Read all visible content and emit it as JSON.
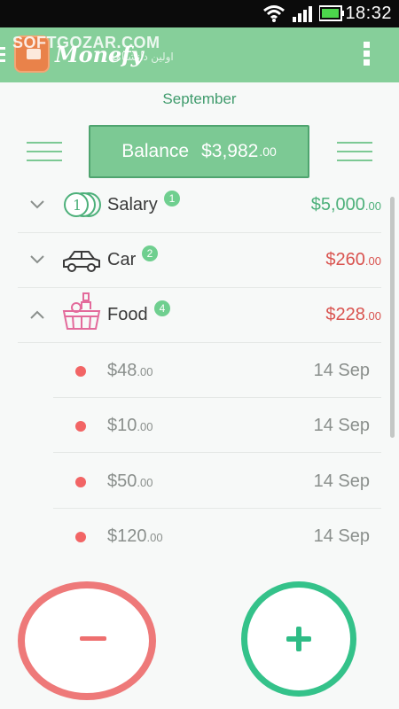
{
  "status_bar": {
    "time": "18:32",
    "icons": [
      "wifi-icon",
      "signal-icon",
      "battery-icon"
    ]
  },
  "app_bar": {
    "app_name": "Monefy",
    "watermark": "SOFTGOZAR.COM",
    "watermark_sub": "اولین دانشنامه",
    "icons": [
      "navigation-icon",
      "wallet-logo-icon",
      "overflow-menu-icon"
    ]
  },
  "month": "September",
  "balance": {
    "label": "Balance",
    "amount": "$3,982",
    "cents": ".00"
  },
  "categories": [
    {
      "name": "Salary",
      "badge": "1",
      "amount": "$5,000",
      "cents": ".00",
      "color": "#4db07a",
      "icon": "coins-icon",
      "expanded": false
    },
    {
      "name": "Car",
      "badge": "2",
      "amount": "$260",
      "cents": ".00",
      "color": "#d9534f",
      "icon": "car-icon",
      "expanded": false
    },
    {
      "name": "Food",
      "badge": "4",
      "amount": "$228",
      "cents": ".00",
      "color": "#d9534f",
      "icon": "food-basket-icon",
      "expanded": true
    }
  ],
  "food_entries": [
    {
      "amount": "$48",
      "cents": ".00",
      "date": "14 Sep"
    },
    {
      "amount": "$10",
      "cents": ".00",
      "date": "14 Sep"
    },
    {
      "amount": "$50",
      "cents": ".00",
      "date": "14 Sep"
    },
    {
      "amount": "$120",
      "cents": ".00",
      "date": "14 Sep"
    }
  ],
  "actions": {
    "expense_icon": "minus-icon",
    "income_icon": "plus-icon"
  },
  "colors": {
    "app_bar": "#86cf9a",
    "income": "#4db07a",
    "expense": "#d9534f",
    "minus_button": "#ee7979",
    "plus_button": "#34c28a"
  }
}
